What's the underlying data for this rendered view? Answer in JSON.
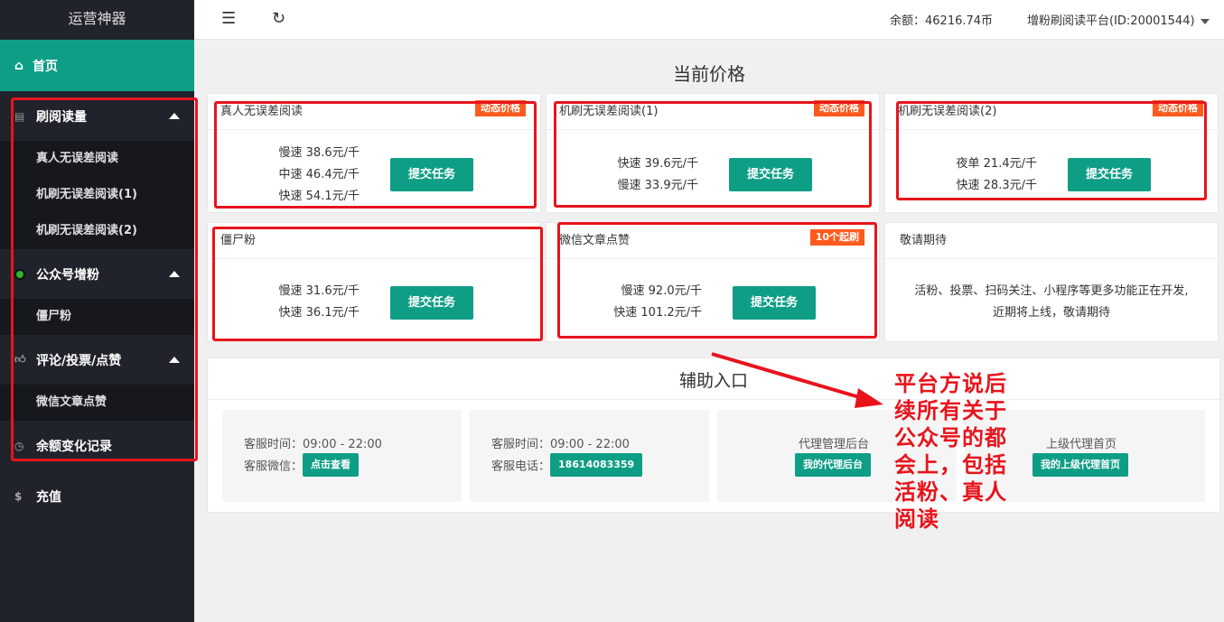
{
  "app": {
    "title": "运营神器"
  },
  "sidebar": {
    "home": "首页",
    "groups": [
      {
        "label": "刷阅读量",
        "items": [
          "真人无误差阅读",
          "机刷无误差阅读(1)",
          "机刷无误差阅读(2)"
        ]
      },
      {
        "label": "公众号增粉",
        "items": [
          "僵尸粉"
        ]
      },
      {
        "label": "评论/投票/点赞",
        "items": [
          "微信文章点赞"
        ]
      }
    ],
    "balance_log": "余额变化记录",
    "recharge": "充值"
  },
  "header": {
    "balance_label": "余额：46216.74币",
    "platform": "增粉刷阅读平台(ID:20001544)"
  },
  "prices": {
    "title": "当前价格",
    "submit_label": "提交任务",
    "cards": [
      {
        "title": "真人无误差阅读",
        "badge": "动态价格",
        "lines": [
          "慢速 38.6元/千",
          "中速 46.4元/千",
          "快速 54.1元/千"
        ]
      },
      {
        "title": "机刷无误差阅读(1)",
        "badge": "动态价格",
        "lines": [
          "快速 39.6元/千",
          "慢速 33.9元/千"
        ]
      },
      {
        "title": "机刷无误差阅读(2)",
        "badge": "动态价格",
        "lines": [
          "夜单 21.4元/千",
          "快速 28.3元/千"
        ]
      },
      {
        "title": "僵尸粉",
        "badge": "",
        "lines": [
          "慢速 31.6元/千",
          "快速 36.1元/千"
        ]
      },
      {
        "title": "微信文章点赞",
        "badge": "10个起刷",
        "lines": [
          "慢速 92.0元/千",
          "快速 101.2元/千"
        ]
      }
    ],
    "coming": {
      "title": "敬请期待",
      "text1": "活粉、投票、扫码关注、小程序等更多功能正在开发,",
      "text2": "近期将上线，敬请期待"
    }
  },
  "aux": {
    "title": "辅助入口",
    "box1": {
      "line1": "客服时间：09:00 - 22:00",
      "label2": "客服微信：",
      "button": "点击查看"
    },
    "box2": {
      "line1": "客服时间：09:00 - 22:00",
      "label2": "客服电话：",
      "button": "18614083359"
    },
    "box3": {
      "line1": "代理管理后台",
      "button": "我的代理后台"
    },
    "box4": {
      "line1": "上级代理首页",
      "button": "我的上级代理首页"
    }
  },
  "annotation": "平台方说后续所有关于公众号的都会上，包括活粉、真人阅读",
  "colors": {
    "accent": "#0e9e86",
    "sidebar": "#20232b",
    "badge": "#ff5a1e",
    "annotation": "#e8141c"
  }
}
